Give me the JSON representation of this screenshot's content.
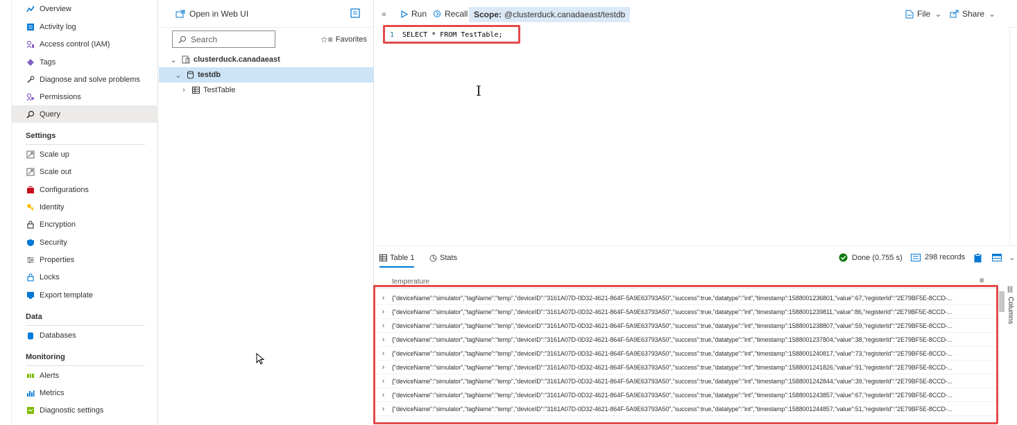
{
  "nav": {
    "items": [
      {
        "label": "Overview",
        "icon": "overview-icon",
        "color": "#0078d4"
      },
      {
        "label": "Activity log",
        "icon": "activity-log-icon",
        "color": "#0078d4"
      },
      {
        "label": "Access control (IAM)",
        "icon": "iam-icon",
        "color": "#5c2d91"
      },
      {
        "label": "Tags",
        "icon": "tag-icon",
        "color": "#8661c5"
      },
      {
        "label": "Diagnose and solve problems",
        "icon": "wrench-icon",
        "color": "#323130"
      },
      {
        "label": "Permissions",
        "icon": "permissions-icon",
        "color": "#5c2d91"
      },
      {
        "label": "Query",
        "icon": "query-icon",
        "color": "#323130"
      }
    ],
    "settings_label": "Settings",
    "settings": [
      {
        "label": "Scale up",
        "icon": "scale-up-icon"
      },
      {
        "label": "Scale out",
        "icon": "scale-out-icon"
      },
      {
        "label": "Configurations",
        "icon": "toolbox-icon"
      },
      {
        "label": "Identity",
        "icon": "key-icon"
      },
      {
        "label": "Encryption",
        "icon": "lock-icon"
      },
      {
        "label": "Security",
        "icon": "shield-icon"
      },
      {
        "label": "Properties",
        "icon": "properties-icon"
      },
      {
        "label": "Locks",
        "icon": "lock-icon"
      },
      {
        "label": "Export template",
        "icon": "export-template-icon"
      }
    ],
    "data_label": "Data",
    "data": [
      {
        "label": "Databases",
        "icon": "database-icon"
      }
    ],
    "monitoring_label": "Monitoring",
    "monitoring": [
      {
        "label": "Alerts",
        "icon": "alerts-icon"
      },
      {
        "label": "Metrics",
        "icon": "metrics-icon"
      },
      {
        "label": "Diagnostic settings",
        "icon": "diagnostic-settings-icon"
      }
    ]
  },
  "tree": {
    "open_web_ui": "Open in Web UI",
    "search_placeholder": "Search",
    "favorites": "Favorites",
    "cluster": "clusterduck.canadaeast",
    "database": "testdb",
    "table": "TestTable"
  },
  "toolbar": {
    "run": "Run",
    "recall": "Recall",
    "scope_label": "Scope:",
    "scope_value": "@clusterduck.canadaeast/testdb",
    "file": "File",
    "share": "Share"
  },
  "editor": {
    "line_number": "1",
    "query": "SELECT * FROM TestTable;"
  },
  "results": {
    "tab_table": "Table 1",
    "tab_stats": "Stats",
    "status": "Done (0.755 s)",
    "records": "298 records",
    "column": "temperature",
    "columns_label": "Columns",
    "rows": [
      "{\"deviceName\":\"simulator\",\"tagName\":\"temp\",\"deviceID\":\"3161A07D-0D32-4621-864F-5A9E63793A50\",\"success\":true,\"datatype\":\"int\",\"timestamp\":1588001236801,\"value\":67,\"registerId\":\"2E79BF5E-8CCD-...",
      "{\"deviceName\":\"simulator\",\"tagName\":\"temp\",\"deviceID\":\"3161A07D-0D32-4621-864F-5A9E63793A50\",\"success\":true,\"datatype\":\"int\",\"timestamp\":1588001239811,\"value\":86,\"registerId\":\"2E79BF5E-8CCD-...",
      "{\"deviceName\":\"simulator\",\"tagName\":\"temp\",\"deviceID\":\"3161A07D-0D32-4621-864F-5A9E63793A50\",\"success\":true,\"datatype\":\"int\",\"timestamp\":1588001238807,\"value\":59,\"registerId\":\"2E79BF5E-8CCD-...",
      "{\"deviceName\":\"simulator\",\"tagName\":\"temp\",\"deviceID\":\"3161A07D-0D32-4621-864F-5A9E63793A50\",\"success\":true,\"datatype\":\"int\",\"timestamp\":1588001237804,\"value\":38,\"registerId\":\"2E79BF5E-8CCD-...",
      "{\"deviceName\":\"simulator\",\"tagName\":\"temp\",\"deviceID\":\"3161A07D-0D32-4621-864F-5A9E63793A50\",\"success\":true,\"datatype\":\"int\",\"timestamp\":1588001240817,\"value\":73,\"registerId\":\"2E79BF5E-8CCD-...",
      "{\"deviceName\":\"simulator\",\"tagName\":\"temp\",\"deviceID\":\"3161A07D-0D32-4621-864F-5A9E63793A50\",\"success\":true,\"datatype\":\"int\",\"timestamp\":1588001241826,\"value\":91,\"registerId\":\"2E79BF5E-8CCD-...",
      "{\"deviceName\":\"simulator\",\"tagName\":\"temp\",\"deviceID\":\"3161A07D-0D32-4621-864F-5A9E63793A50\",\"success\":true,\"datatype\":\"int\",\"timestamp\":1588001242844,\"value\":39,\"registerId\":\"2E79BF5E-8CCD-...",
      "{\"deviceName\":\"simulator\",\"tagName\":\"temp\",\"deviceID\":\"3161A07D-0D32-4621-864F-5A9E63793A50\",\"success\":true,\"datatype\":\"int\",\"timestamp\":1588001243857,\"value\":67,\"registerId\":\"2E79BF5E-8CCD-...",
      "{\"deviceName\":\"simulator\",\"tagName\":\"temp\",\"deviceID\":\"3161A07D-0D32-4621-864F-5A9E63793A50\",\"success\":true,\"datatype\":\"int\",\"timestamp\":1588001244857,\"value\":51,\"registerId\":\"2E79BF5E-8CCD-..."
    ]
  },
  "colors": {
    "accent": "#0078d4",
    "selected_tree": "#cce4f6",
    "scope_bg": "#dbe9f7",
    "highlight_box": "#e34a4a",
    "done_green": "#107c10"
  }
}
